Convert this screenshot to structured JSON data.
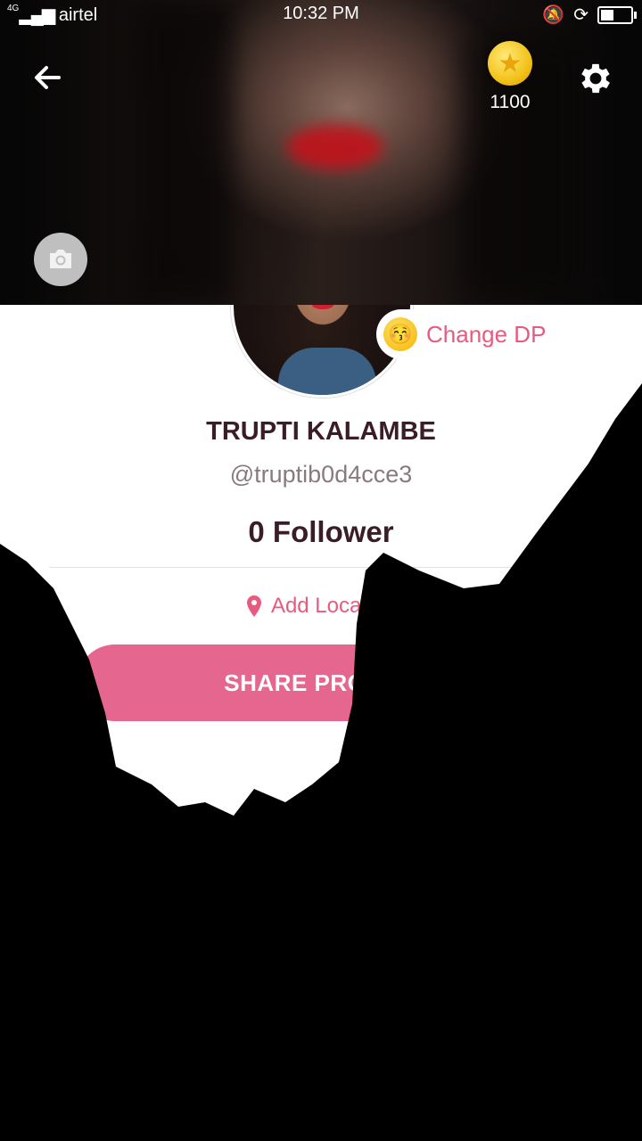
{
  "status_bar": {
    "network": "4G",
    "carrier": "airtel",
    "time": "10:32 PM",
    "battery_level_percent": 45
  },
  "header": {
    "back_icon": "arrow-left-icon",
    "coin_icon": "coin-star-icon",
    "coin_count": "1100",
    "settings_icon": "gear-icon",
    "camera_icon": "camera-icon"
  },
  "profile": {
    "change_dp_emoji": "😚",
    "change_dp_label": "Change DP",
    "name": "TRUPTI KALAMBE",
    "handle": "@truptib0d4cce3",
    "followers": "0 Follower",
    "location_icon": "location-pin-icon",
    "location_label": "Add Location",
    "share_button": "SHARE PROFILE"
  },
  "colors": {
    "accent_pink": "#e85a7f",
    "share_button_bg": "#e5668f",
    "name_text": "#3a1d26",
    "coin_gold": "#f3c21a"
  }
}
